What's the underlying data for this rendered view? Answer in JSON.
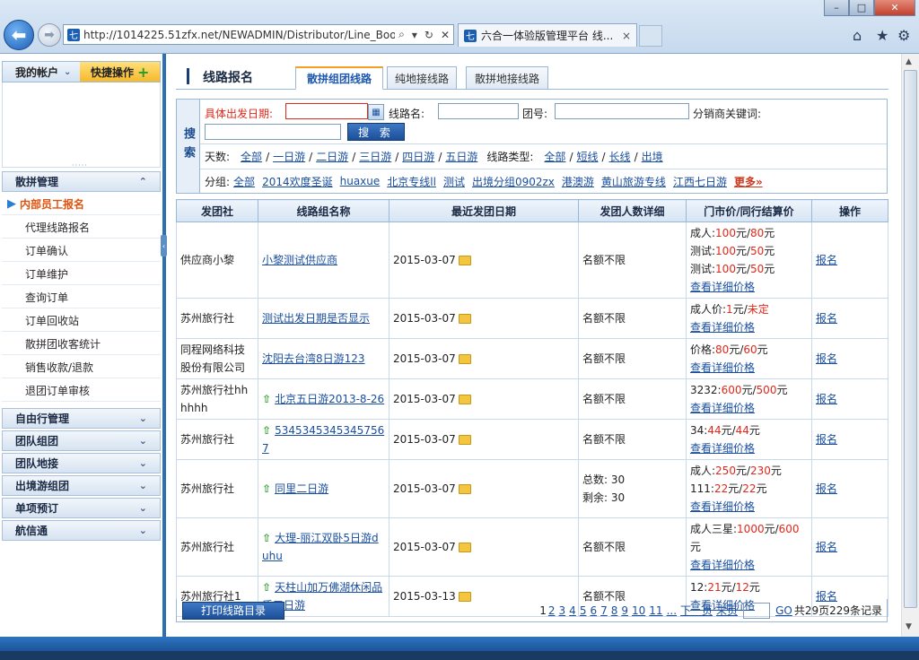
{
  "browser": {
    "url": "http://1014225.51zfx.net/NEWADMIN/Distributor/Line_Boo",
    "tab_title": "六合一体验版管理平台 线...",
    "favicon": "七",
    "back_icon": "back-arrow-icon",
    "close_glyph": "×"
  },
  "sidebar": {
    "account_label": "我的帐户",
    "quick_label": "快捷操作",
    "plus_glyph": "+",
    "sections": [
      {
        "label": "散拼管理",
        "arrow": "⌃"
      },
      {
        "label": "自由行管理",
        "arrow": "⌄"
      },
      {
        "label": "团队组团",
        "arrow": "⌄"
      },
      {
        "label": "团队地接",
        "arrow": "⌄"
      },
      {
        "label": "出境游组团",
        "arrow": "⌄"
      },
      {
        "label": "单项预订",
        "arrow": "⌄"
      },
      {
        "label": "航信通",
        "arrow": "⌄"
      }
    ],
    "items": [
      "内部员工报名",
      "代理线路报名",
      "订单确认",
      "订单维护",
      "查询订单",
      "订单回收站",
      "散拼团收客统计",
      "销售收款/退款",
      "退团订单审核"
    ]
  },
  "header": {
    "title": "线路报名",
    "tabs": [
      "散拼组团线路",
      "纯地接线路",
      "散拼地接线路"
    ]
  },
  "search": {
    "section_label": "搜索",
    "date_label": "具体出发日期:",
    "line_name_label": "线路名:",
    "group_no_label": "团号:",
    "keyword_label": "分销商关键词:",
    "search_button": "搜 索",
    "days_label": "天数:",
    "days": [
      "全部",
      "一日游",
      "二日游",
      "三日游",
      "四日游",
      "五日游"
    ],
    "line_type_label": "线路类型:",
    "line_types": [
      "全部",
      "短线",
      "长线",
      "出境"
    ],
    "group_label": "分组:",
    "groups": [
      "全部",
      "2014欢度圣诞",
      "huaxue",
      "北京专线ll",
      "测试",
      "出境分组0902zx",
      "港澳游",
      "黄山旅游专线",
      "江西七日游"
    ],
    "more": "更多»"
  },
  "table": {
    "headers": [
      "发团社",
      "线路组名称",
      "最近发团日期",
      "发团人数详细",
      "门市价/同行结算价",
      "操作"
    ],
    "detail_link": "查看详细价格",
    "action": "报名",
    "rows": [
      {
        "agency": "供应商小黎",
        "name": "小黎测试供应商",
        "date": "2015-03-07",
        "people": [
          "名额不限"
        ],
        "prices": [
          [
            "成人:",
            "100",
            "元/",
            "80",
            "元"
          ],
          [
            "测试:",
            "100",
            "元/",
            "50",
            "元"
          ],
          [
            "测试:",
            "100",
            "元/",
            "50",
            "元"
          ]
        ]
      },
      {
        "agency": "苏州旅行社",
        "name": "测试出发日期是否显示",
        "date": "2015-03-07",
        "people": [
          "名额不限"
        ],
        "prices": [
          [
            "成人价:",
            "1",
            "元/",
            "未定",
            ""
          ]
        ]
      },
      {
        "agency": "同程网络科技股份有限公司",
        "name": "沈阳去台湾8日游123",
        "date": "2015-03-07",
        "people": [
          "名额不限"
        ],
        "prices": [
          [
            "价格:",
            "80",
            "元/",
            "60",
            "元"
          ]
        ]
      },
      {
        "agency": "苏州旅行社hhhhhh",
        "name": "北京五日游2013-8-26",
        "date": "2015-03-07",
        "people": [
          "名额不限"
        ],
        "prices": [
          [
            "3232:",
            "600",
            "元/",
            "500",
            "元"
          ]
        ]
      },
      {
        "agency": "苏州旅行社",
        "name": "53453453453457567",
        "date": "2015-03-07",
        "people": [
          "名额不限"
        ],
        "prices": [
          [
            "34:",
            "44",
            "元/",
            "44",
            "元"
          ]
        ]
      },
      {
        "agency": "苏州旅行社",
        "name": "同里二日游",
        "date": "2015-03-07",
        "people": [
          "总数: 30",
          "剩余: 30"
        ],
        "prices": [
          [
            "成人:",
            "250",
            "元/",
            "230",
            "元"
          ],
          [
            "111:",
            "22",
            "元/",
            "22",
            "元"
          ]
        ]
      },
      {
        "agency": "苏州旅行社",
        "name": "大理-丽江双卧5日游duhu",
        "date": "2015-03-07",
        "people": [
          "名额不限"
        ],
        "prices": [
          [
            "成人三星:",
            "1000",
            "元/",
            "600",
            "元"
          ]
        ]
      },
      {
        "agency": "苏州旅行社1",
        "name": "天柱山加万佛湖休闲品质三日游",
        "date": "2015-03-13",
        "people": [
          "名额不限"
        ],
        "prices": [
          [
            "12:",
            "21",
            "元/",
            "12",
            "元"
          ]
        ]
      }
    ]
  },
  "footer": {
    "print_button": "打印线路目录",
    "current_page": "1",
    "pages": [
      "2",
      "3",
      "4",
      "5",
      "6",
      "7",
      "8",
      "9",
      "10",
      "11",
      "..."
    ],
    "next": "下一页",
    "last": "末页",
    "go": "GO",
    "summary": "共29页229条记录"
  }
}
